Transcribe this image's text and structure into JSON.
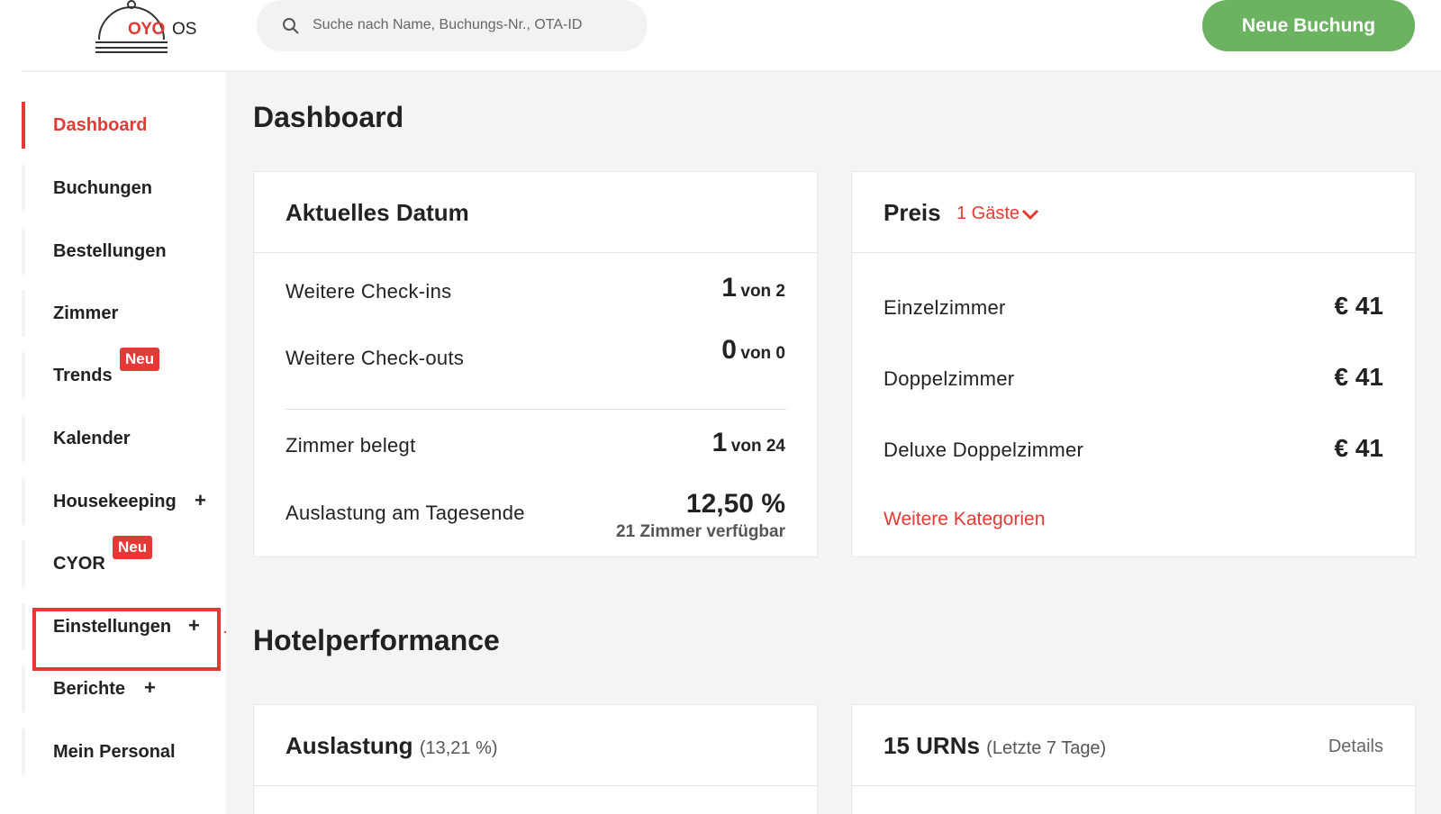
{
  "header": {
    "logo_brand": "OYO",
    "logo_suffix": "OS",
    "search_placeholder": "Suche nach Name, Buchungs-Nr., OTA-ID",
    "new_booking_label": "Neue Buchung"
  },
  "sidebar": {
    "items": [
      {
        "label": "Dashboard",
        "active": true
      },
      {
        "label": "Buchungen"
      },
      {
        "label": "Bestellungen"
      },
      {
        "label": "Zimmer"
      },
      {
        "label": "Trends",
        "badge": "Neu"
      },
      {
        "label": "Kalender"
      },
      {
        "label": "Housekeeping",
        "expand": "+"
      },
      {
        "label": "CYOR",
        "badge": "Neu"
      },
      {
        "label": "Einstellungen",
        "expand": "+",
        "highlighted": true
      },
      {
        "label": "Berichte",
        "expand": "+"
      },
      {
        "label": "Mein Personal"
      }
    ]
  },
  "main": {
    "page_title": "Dashboard",
    "current_date_card": {
      "title": "Aktuelles Datum",
      "rows": [
        {
          "label": "Weitere Check-ins",
          "value": "1",
          "of": "von 2"
        },
        {
          "label": "Weitere Check-outs",
          "value": "0",
          "of": "von 0"
        },
        {
          "label": "Zimmer belegt",
          "value": "1",
          "of": "von 24"
        },
        {
          "label": "Auslastung am Tagesende",
          "value": "12,50 %",
          "sub": "21 Zimmer verfügbar"
        }
      ]
    },
    "price_card": {
      "title": "Preis",
      "guest_select": "1 Gäste",
      "rows": [
        {
          "label": "Einzelzimmer",
          "price": "€ 41"
        },
        {
          "label": "Doppelzimmer",
          "price": "€ 41"
        },
        {
          "label": "Deluxe Doppelzimmer",
          "price": "€ 41"
        }
      ],
      "more_link": "Weitere Kategorien"
    },
    "section_title": "Hotelperformance",
    "occupancy_card": {
      "title": "Auslastung",
      "subtitle": "(13,21 %)"
    },
    "urn_card": {
      "title": "15 URNs",
      "subtitle": "(Letzte 7 Tage)",
      "details_link": "Details"
    }
  },
  "colors": {
    "accent_red": "#e53935",
    "button_green": "#6cb361",
    "main_bg": "#f4f4f4"
  }
}
